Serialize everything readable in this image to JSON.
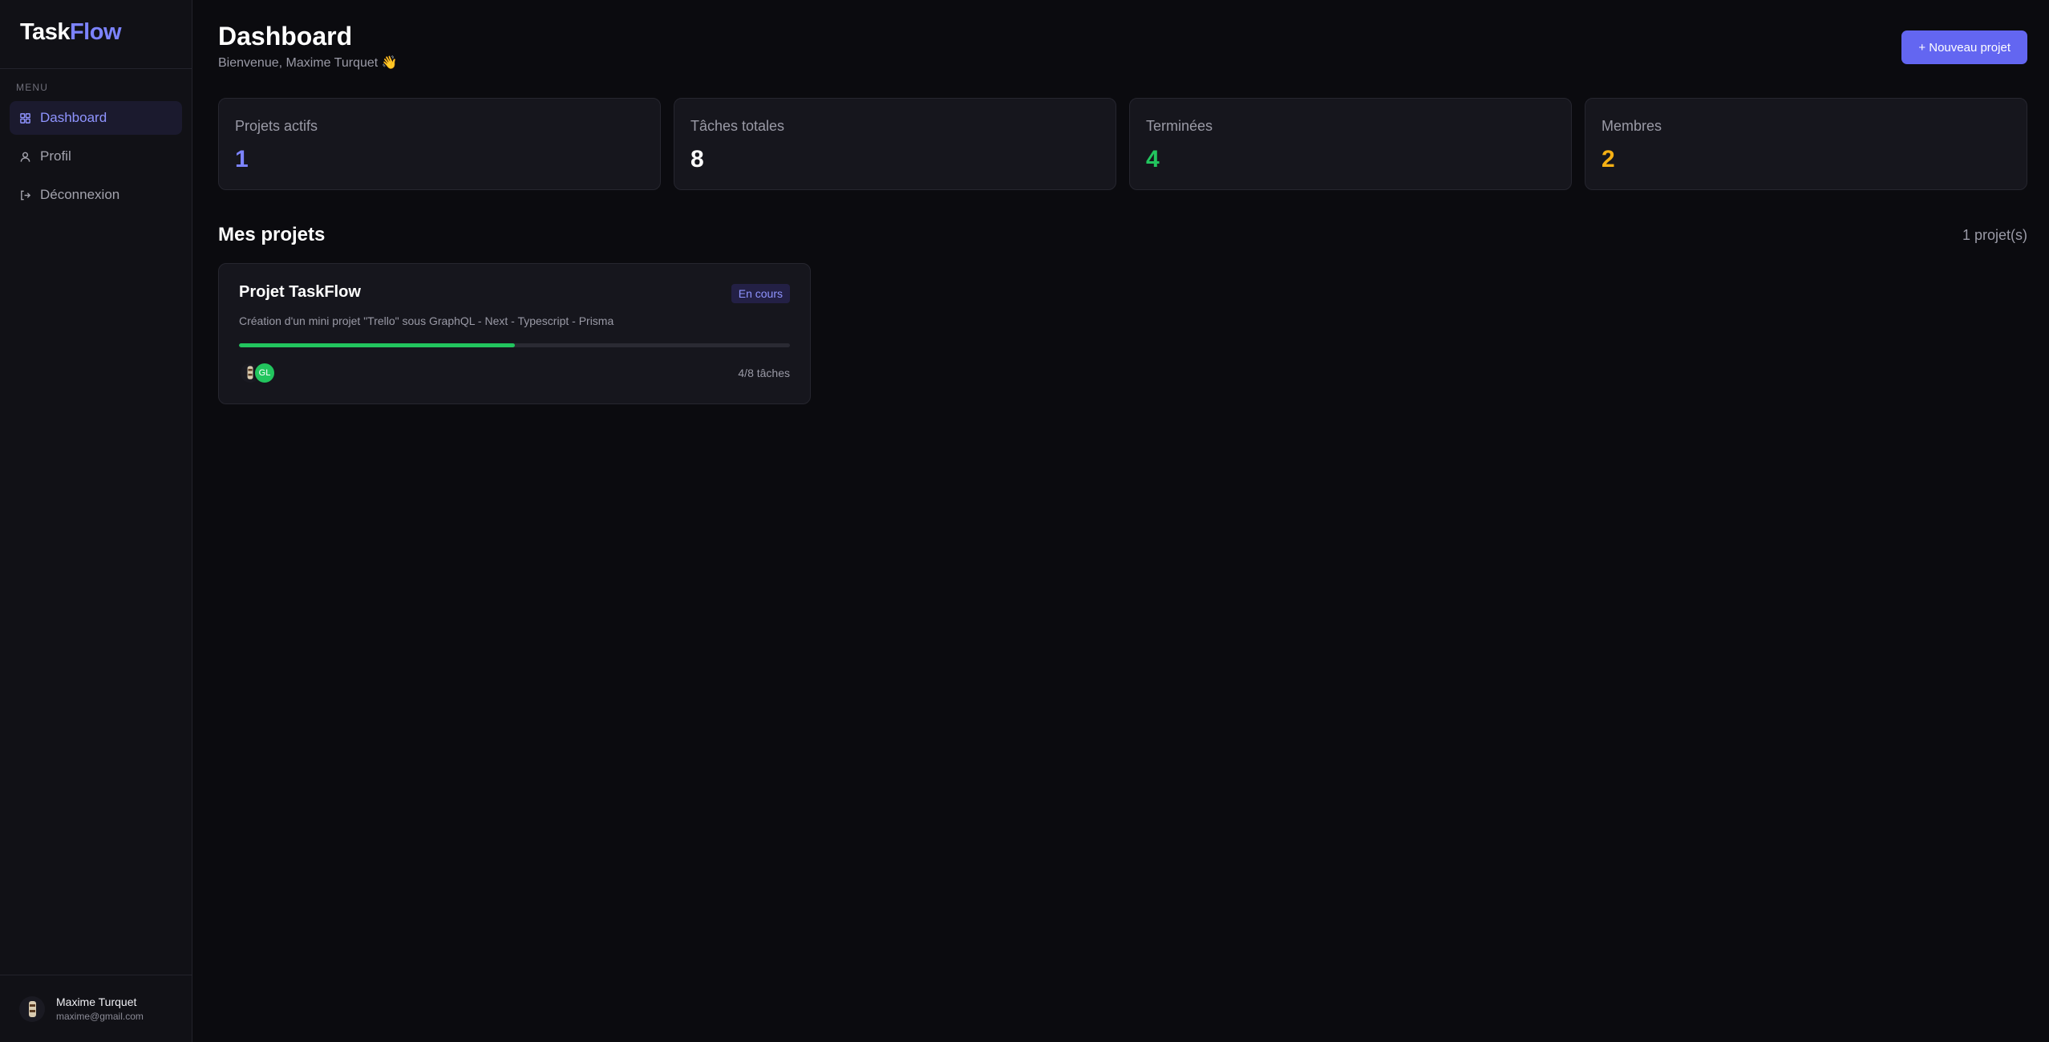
{
  "logo": {
    "part1": "Task",
    "part2": "Flow"
  },
  "sidebar": {
    "menu_label": "MENU",
    "items": [
      {
        "label": "Dashboard",
        "icon": "grid-icon",
        "active": true
      },
      {
        "label": "Profil",
        "icon": "user-icon",
        "active": false
      },
      {
        "label": "Déconnexion",
        "icon": "logout-icon",
        "active": false
      }
    ],
    "user": {
      "name": "Maxime Turquet",
      "email": "maxime@gmail.com"
    }
  },
  "header": {
    "title": "Dashboard",
    "subtitle": "Bienvenue, Maxime Turquet 👋",
    "new_project_label": "+ Nouveau projet"
  },
  "stats": [
    {
      "label": "Projets actifs",
      "value": "1",
      "color": "#7c83ff"
    },
    {
      "label": "Tâches totales",
      "value": "8",
      "color": "#ffffff"
    },
    {
      "label": "Terminées",
      "value": "4",
      "color": "#22c55e"
    },
    {
      "label": "Membres",
      "value": "2",
      "color": "#f5b014"
    }
  ],
  "projects_section": {
    "title": "Mes projets",
    "count": "1 projet(s)"
  },
  "project": {
    "title": "Projet TaskFlow",
    "status": "En cours",
    "description": "Création d'un mini projet \"Trello\" sous GraphQL - Next - Typescript - Prisma",
    "progress": 0.5,
    "members": [
      "GL"
    ],
    "tasks": "4/8 tâches"
  },
  "colors": {
    "accent": "#6366f1",
    "accent_text": "#7c83ff",
    "success": "#22c55e",
    "warning": "#f5b014",
    "background": "#0b0b0f"
  }
}
